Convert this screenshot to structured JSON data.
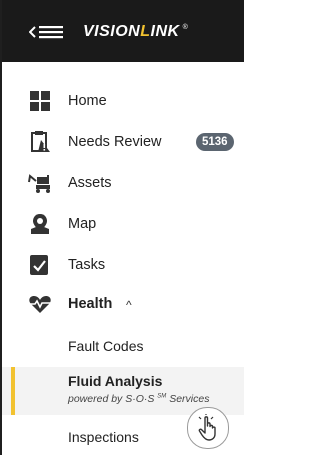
{
  "brand": {
    "part1": "VISION",
    "part2": "L",
    "part3": "INK",
    "reg": "®"
  },
  "nav": {
    "home": "Home",
    "needs_review": "Needs Review",
    "needs_review_count": "5136",
    "assets": "Assets",
    "map": "Map",
    "tasks": "Tasks",
    "health": "Health",
    "health_chevron": "^"
  },
  "health_sub": {
    "fault_codes": "Fault Codes",
    "fluid_analysis": "Fluid Analysis",
    "fluid_powered_prefix": "powered by S·O·S",
    "fluid_powered_sm": "SM",
    "fluid_powered_suffix": " Services",
    "inspections": "Inspections"
  },
  "colors": {
    "accent": "#f2c230",
    "topbar": "#1a1a1a",
    "badge": "#5b6570",
    "active_bg": "#f3f3f3"
  },
  "icons": [
    "menu-collapse-icon",
    "home-grid-icon",
    "needs-review-icon",
    "assets-icon",
    "map-icon",
    "tasks-icon",
    "health-icon",
    "hand-tap-icon"
  ]
}
